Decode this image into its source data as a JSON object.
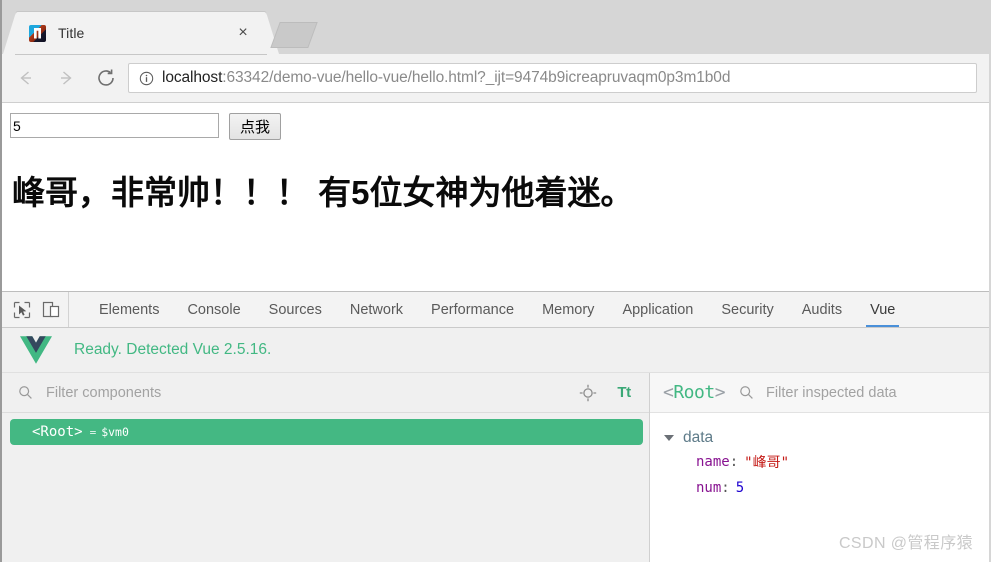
{
  "browser": {
    "tab": {
      "title": "Title",
      "favicon_name": "intellij-idea-favicon",
      "close_label": "×"
    },
    "newtab_label": "",
    "nav": {
      "back_label": "",
      "forward_label": "",
      "reload_label": ""
    },
    "omnibox": {
      "host": "localhost",
      "rest": ":63342/demo-vue/hello-vue/hello.html?_ijt=9474b9icreapruvaqm0p3m1b0d",
      "full_url": "localhost:63342/demo-vue/hello-vue/hello.html?_ijt=9474b9icreapruvaqm0p3m1b0d"
    }
  },
  "page": {
    "input_value": "5",
    "input_placeholder": "",
    "button_label": "点我",
    "heading": "峰哥，非常帅！！！ 有5位女神为他着迷。"
  },
  "devtools": {
    "tool_icons": [
      {
        "name": "inspect-element-icon"
      },
      {
        "name": "device-toolbar-icon"
      }
    ],
    "tabs": [
      {
        "label": "Elements",
        "active": false
      },
      {
        "label": "Console",
        "active": false
      },
      {
        "label": "Sources",
        "active": false
      },
      {
        "label": "Network",
        "active": false
      },
      {
        "label": "Performance",
        "active": false
      },
      {
        "label": "Memory",
        "active": false
      },
      {
        "label": "Application",
        "active": false
      },
      {
        "label": "Security",
        "active": false
      },
      {
        "label": "Audits",
        "active": false
      },
      {
        "label": "Vue",
        "active": true
      }
    ],
    "active_tab": "Vue",
    "accent_color": "#4a90d9",
    "vue_green": "#42b883"
  },
  "vue_panel": {
    "banner_text": "Ready. Detected Vue 2.5.16.",
    "filter": {
      "placeholder": "Filter components",
      "value": ""
    },
    "toolbar_icons": [
      {
        "name": "select-component-target-icon"
      },
      {
        "name": "text-size-icon",
        "label": "Tt"
      }
    ],
    "tree": {
      "nodes": [
        {
          "label": "<Root>",
          "equals": "=",
          "instance": "$vm0",
          "selected": true
        }
      ]
    },
    "inspector": {
      "title": "<Root>",
      "title_open": "<",
      "title_name": "Root",
      "title_close": ">",
      "filter": {
        "placeholder": "Filter inspected data",
        "value": ""
      },
      "groups": [
        {
          "name": "data",
          "expanded": true,
          "props": [
            {
              "key": "name",
              "value": "\"峰哥\"",
              "type": "string"
            },
            {
              "key": "num",
              "value": "5",
              "type": "number"
            }
          ]
        }
      ]
    }
  },
  "watermark": {
    "text": "CSDN @管程序猿"
  }
}
